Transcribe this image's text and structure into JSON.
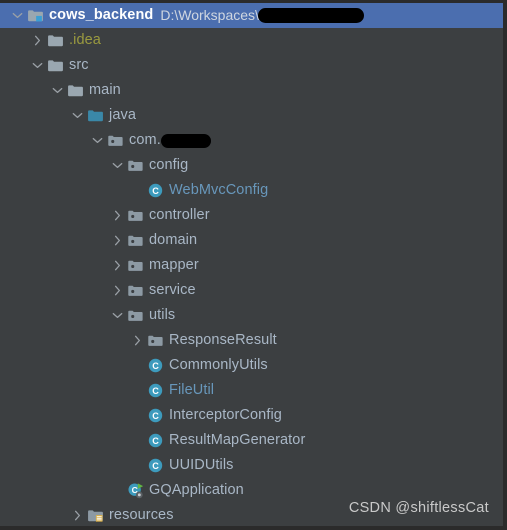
{
  "window": {
    "background_color": "#3c3f41",
    "selection_color": "#4b6eaf",
    "text_color": "#a9b7c6"
  },
  "watermark": "CSDN @shiftlessCat",
  "header": {
    "project_name": "cows_backend",
    "project_path": "D:\\Workspaces\\",
    "path_redacted": true
  },
  "tree": {
    "rows": [
      {
        "label": "cows_backend",
        "suffix": "D:\\Workspaces\\",
        "depth": 0,
        "icon": "module-folder-icon",
        "twisty": "chevron-down-icon",
        "selected": true,
        "style": "bold",
        "redacted": "head"
      },
      {
        "label": ".idea",
        "depth": 1,
        "icon": "folder-icon",
        "twisty": "chevron-right-icon",
        "selected": false,
        "style": "olive"
      },
      {
        "label": "src",
        "depth": 1,
        "icon": "folder-icon",
        "twisty": "chevron-down-icon",
        "selected": false,
        "style": "normal"
      },
      {
        "label": "main",
        "depth": 2,
        "icon": "folder-icon",
        "twisty": "chevron-down-icon",
        "selected": false,
        "style": "normal"
      },
      {
        "label": "java",
        "depth": 3,
        "icon": "source-root-folder-icon",
        "twisty": "chevron-down-icon",
        "selected": false,
        "style": "normal"
      },
      {
        "label": "com.",
        "depth": 4,
        "icon": "package-icon",
        "twisty": "chevron-down-icon",
        "selected": false,
        "style": "normal",
        "redacted": "pkg"
      },
      {
        "label": "config",
        "depth": 5,
        "icon": "package-icon",
        "twisty": "chevron-down-icon",
        "selected": false,
        "style": "normal"
      },
      {
        "label": "WebMvcConfig",
        "depth": 6,
        "icon": "java-class-icon",
        "twisty": "none",
        "selected": false,
        "style": "blue"
      },
      {
        "label": "controller",
        "depth": 5,
        "icon": "package-icon",
        "twisty": "chevron-right-icon",
        "selected": false,
        "style": "normal"
      },
      {
        "label": "domain",
        "depth": 5,
        "icon": "package-icon",
        "twisty": "chevron-right-icon",
        "selected": false,
        "style": "normal"
      },
      {
        "label": "mapper",
        "depth": 5,
        "icon": "package-icon",
        "twisty": "chevron-right-icon",
        "selected": false,
        "style": "normal"
      },
      {
        "label": "service",
        "depth": 5,
        "icon": "package-icon",
        "twisty": "chevron-right-icon",
        "selected": false,
        "style": "normal"
      },
      {
        "label": "utils",
        "depth": 5,
        "icon": "package-icon",
        "twisty": "chevron-down-icon",
        "selected": false,
        "style": "normal"
      },
      {
        "label": "ResponseResult",
        "depth": 6,
        "icon": "package-icon",
        "twisty": "chevron-right-icon",
        "selected": false,
        "style": "normal"
      },
      {
        "label": "CommonlyUtils",
        "depth": 6,
        "icon": "java-class-icon",
        "twisty": "none",
        "selected": false,
        "style": "normal"
      },
      {
        "label": "FileUtil",
        "depth": 6,
        "icon": "java-class-icon",
        "twisty": "none",
        "selected": false,
        "style": "blue"
      },
      {
        "label": "InterceptorConfig",
        "depth": 6,
        "icon": "java-class-icon",
        "twisty": "none",
        "selected": false,
        "style": "normal"
      },
      {
        "label": "ResultMapGenerator",
        "depth": 6,
        "icon": "java-class-icon",
        "twisty": "none",
        "selected": false,
        "style": "normal"
      },
      {
        "label": "UUIDUtils",
        "depth": 6,
        "icon": "java-class-icon",
        "twisty": "none",
        "selected": false,
        "style": "normal"
      },
      {
        "label": "GQApplication",
        "depth": 5,
        "icon": "spring-boot-application-icon",
        "twisty": "none",
        "selected": false,
        "style": "normal"
      },
      {
        "label": "resources",
        "depth": 3,
        "icon": "resources-root-folder-icon",
        "twisty": "chevron-right-icon",
        "selected": false,
        "style": "normal"
      }
    ]
  }
}
